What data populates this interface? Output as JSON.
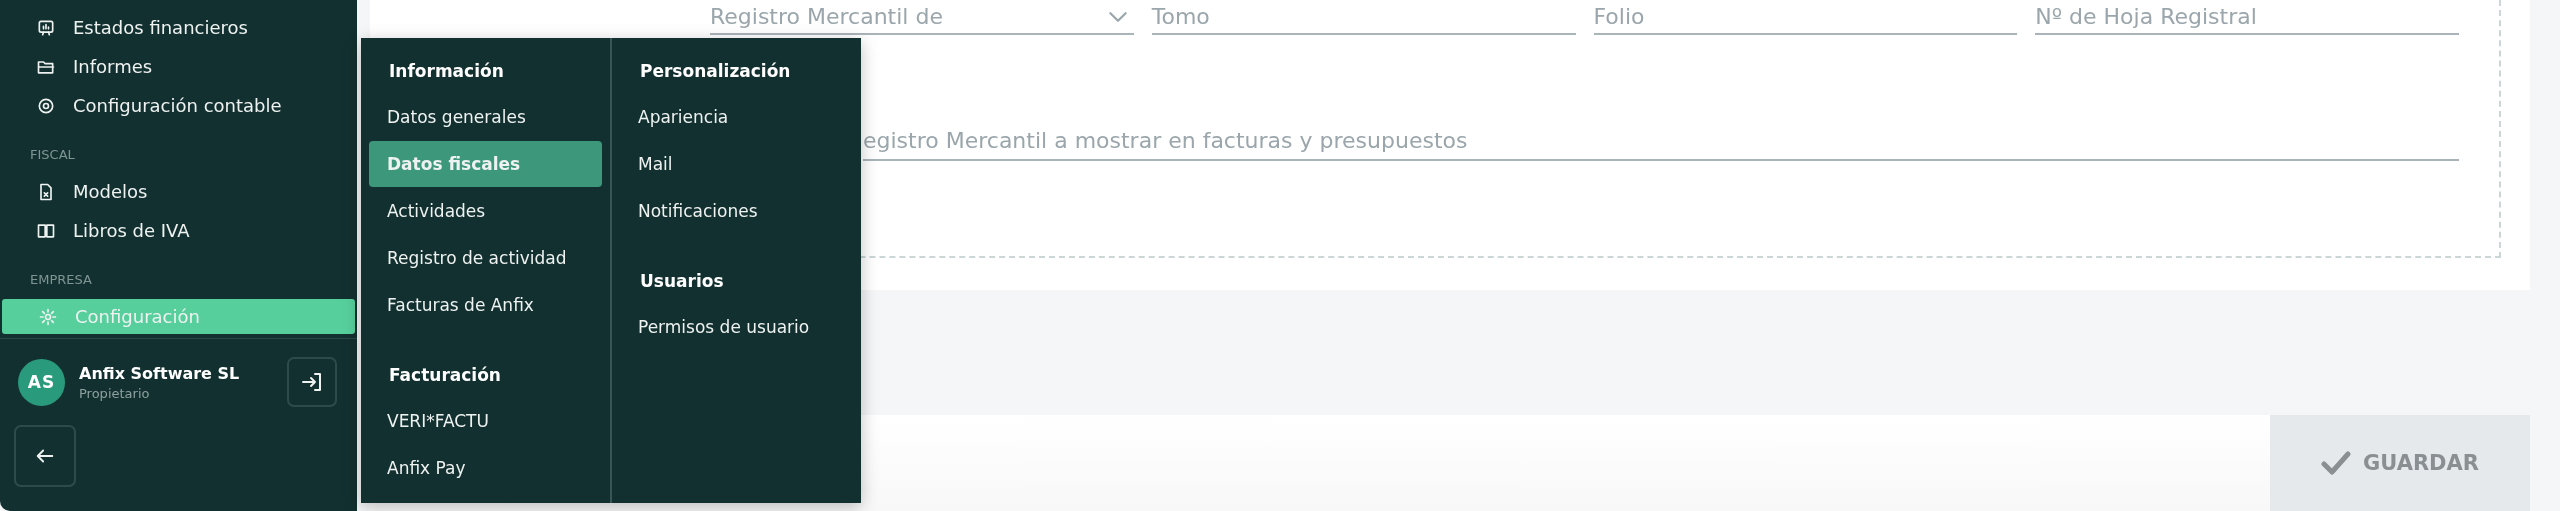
{
  "sidebar": {
    "groups": [
      {
        "items": [
          {
            "label": "Estados financieros",
            "selected": false
          },
          {
            "label": "Informes",
            "selected": false
          },
          {
            "label": "Configuración contable",
            "selected": false
          }
        ]
      },
      {
        "heading": "FISCAL",
        "items": [
          {
            "label": "Modelos",
            "selected": false
          },
          {
            "label": "Libros de IVA",
            "selected": false
          }
        ]
      },
      {
        "heading": "EMPRESA",
        "items": [
          {
            "label": "Configuración",
            "selected": true
          }
        ]
      }
    ],
    "user": {
      "initials": "AS",
      "name": "Anfix Software SL",
      "role": "Propietario"
    }
  },
  "settings_menu": {
    "columns": [
      {
        "sections": [
          {
            "heading": "Información",
            "items": [
              {
                "label": "Datos generales",
                "selected": false
              },
              {
                "label": "Datos fiscales",
                "selected": true
              },
              {
                "label": "Actividades",
                "selected": false
              },
              {
                "label": "Registro de actividad",
                "selected": false
              },
              {
                "label": "Facturas de Anfix",
                "selected": false
              }
            ]
          },
          {
            "heading": "Facturación",
            "items": [
              {
                "label": "VERI*FACTU",
                "selected": false
              },
              {
                "label": "Anfix Pay",
                "selected": false
              }
            ]
          }
        ]
      },
      {
        "sections": [
          {
            "heading": "Personalización",
            "items": [
              {
                "label": "Apariencia",
                "selected": false
              },
              {
                "label": "Mail",
                "selected": false
              },
              {
                "label": "Notificaciones",
                "selected": false
              }
            ]
          },
          {
            "heading": "Usuarios",
            "items": [
              {
                "label": "Permisos de usuario",
                "selected": false
              }
            ]
          }
        ]
      }
    ]
  },
  "form": {
    "fields": [
      {
        "kind": "select",
        "placeholder": "Registro Mercantil de"
      },
      {
        "kind": "text",
        "placeholder": "Tomo"
      },
      {
        "kind": "text",
        "placeholder": "Folio"
      },
      {
        "kind": "text",
        "placeholder": "Nº de Hoja Registral"
      }
    ],
    "note_field": {
      "placeholder": "egistro Mercantil a mostrar en facturas y presupuestos"
    }
  },
  "save_button": {
    "label": "GUARDAR",
    "disabled": true
  }
}
